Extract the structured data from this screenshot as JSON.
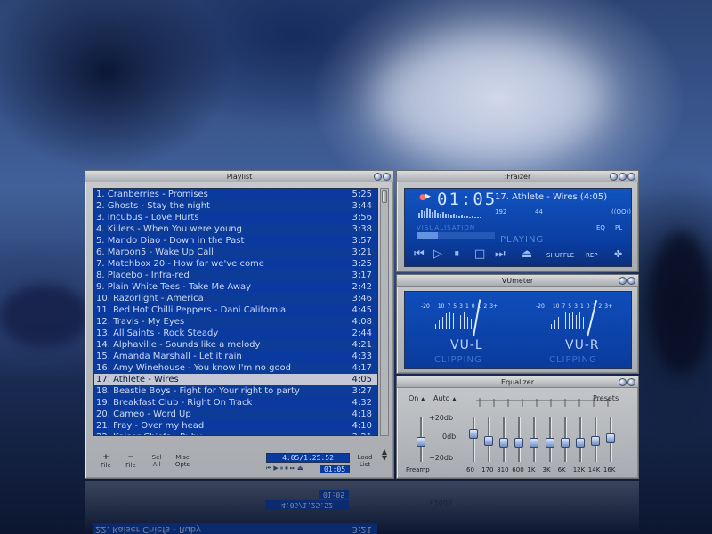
{
  "playlist": {
    "title": "Playlist",
    "tracks": [
      {
        "label": "1. Cranberries - Promises",
        "time": "5:25"
      },
      {
        "label": "2. Ghosts - Stay the night",
        "time": "3:44"
      },
      {
        "label": "3. Incubus - Love Hurts",
        "time": "3:56"
      },
      {
        "label": "4. Killers - When You were young",
        "time": "3:38"
      },
      {
        "label": "5. Mando Diao - Down in the Past",
        "time": "3:57"
      },
      {
        "label": "6. Maroon5 - Wake Up Call",
        "time": "3:21"
      },
      {
        "label": "7. Matchbox 20 - How far we've come",
        "time": "3:25"
      },
      {
        "label": "8. Placebo - Infra-red",
        "time": "3:17"
      },
      {
        "label": "9. Plain White Tees - Take Me Away",
        "time": "2:42"
      },
      {
        "label": "10. Razorlight - America",
        "time": "3:46"
      },
      {
        "label": "11. Red Hot Chilli Peppers - Dani California",
        "time": "4:45"
      },
      {
        "label": "12. Travis - My Eyes",
        "time": "4:08"
      },
      {
        "label": "13. All Saints - Rock Steady",
        "time": "2:44"
      },
      {
        "label": "14. Alphaville - Sounds like a melody",
        "time": "4:21"
      },
      {
        "label": "15. Amanda Marshall - Let it rain",
        "time": "4:33"
      },
      {
        "label": "16. Amy Winehouse - You know I'm no good",
        "time": "4:17"
      },
      {
        "label": "17. Athlete - Wires",
        "time": "4:05"
      },
      {
        "label": "18. Beastie Boys - Fight for Your right to party",
        "time": "3:27"
      },
      {
        "label": "19. Breakfast Club - Right On Track",
        "time": "4:32"
      },
      {
        "label": "20. Cameo - Word Up",
        "time": "4:18"
      },
      {
        "label": "21. Fray - Over my head",
        "time": "4:10"
      },
      {
        "label": "22. Kaiser Chiefs - Ruby",
        "time": "3:21"
      }
    ],
    "selected_index": 16,
    "buttons": {
      "add": {
        "symbol": "+",
        "label": "File"
      },
      "remove": {
        "symbol": "−",
        "label": "File"
      },
      "sel": {
        "top": "Sel",
        "bottom": "All"
      },
      "misc": {
        "top": "Misc",
        "bottom": "Opts"
      },
      "load": {
        "top": "Load",
        "bottom": "List"
      }
    },
    "time_display": "4:05/1:25:52",
    "mini_time": "01:05",
    "mini_controls": [
      "⏮",
      "▶",
      "⏸",
      "⏹",
      "⏭",
      "⏏"
    ]
  },
  "player": {
    "title": ":Fraizer",
    "time": "01:05",
    "track_title": "17. Athlete - Wires (4:05)",
    "bitrate": "192",
    "samplerate": "44",
    "stereo": "((OO))",
    "eq_label": "EQ",
    "pl_label": "PL",
    "vis_label": "VISUALISATION",
    "status": "PLAYING",
    "shuffle": "SHUFFLE",
    "repeat": "REP",
    "progress": 0.27
  },
  "vumeter": {
    "title": "VUmeter",
    "scale": [
      "-20",
      "10",
      "7",
      "5",
      "3",
      "1",
      "0",
      "1",
      "2",
      "3+"
    ],
    "left_label": "VU-L",
    "right_label": "VU-R",
    "clip_label": "CLIPPING"
  },
  "equalizer": {
    "title": "Equalizer",
    "on": "On",
    "auto": "Auto",
    "presets": "Presets",
    "db_plus": "+20db",
    "db_zero": "0db",
    "db_minus": "−20db",
    "preamp_label": "Preamp",
    "bands": [
      "60",
      "170",
      "310",
      "600",
      "1K",
      "3K",
      "6K",
      "12K",
      "14K",
      "16K"
    ],
    "band_levels": [
      0.66,
      0.44,
      0.4,
      0.4,
      0.4,
      0.4,
      0.4,
      0.4,
      0.46,
      0.52
    ],
    "preamp_level": 0.43
  },
  "reflection": {
    "playlist_row": "22. Kaiser Chiefs - Ruby",
    "playlist_row_time": "3:21",
    "time_display": "4:05/1:25:52",
    "mini_time": "01:05",
    "db_plus": "+20db"
  }
}
